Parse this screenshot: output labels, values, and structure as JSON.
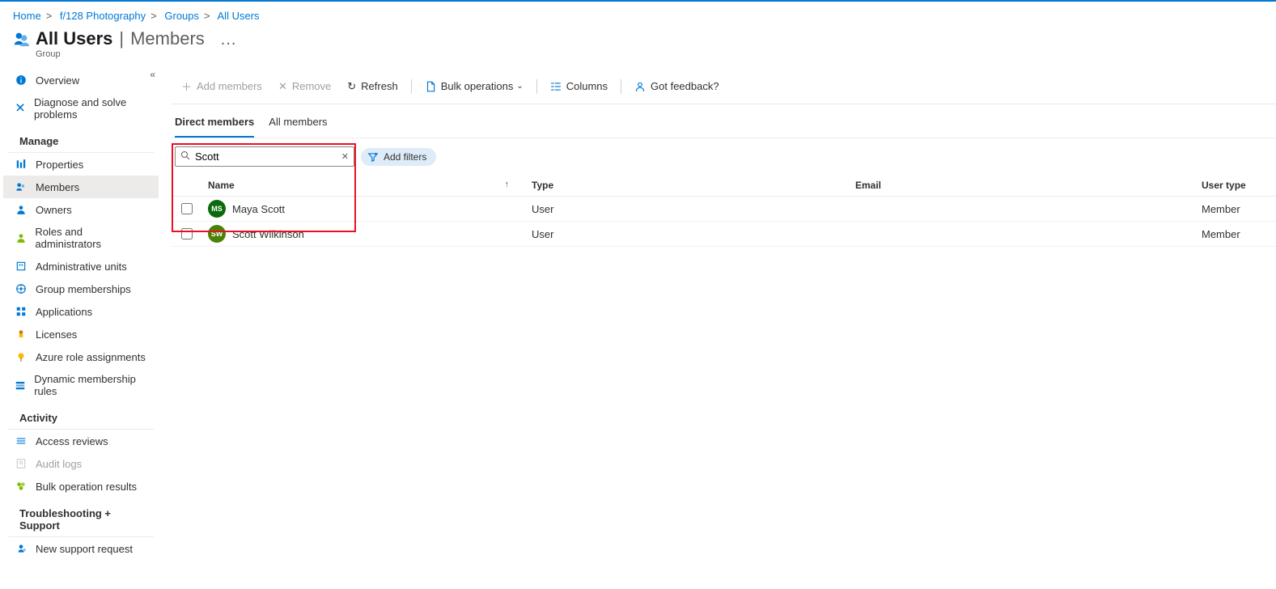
{
  "breadcrumbs": [
    "Home",
    "f/128 Photography",
    "Groups",
    "All Users"
  ],
  "header": {
    "title_main": "All Users",
    "title_second": "Members",
    "subtitle": "Group",
    "more": "..."
  },
  "sidebar": {
    "top": [
      {
        "label": "Overview",
        "icon": "info",
        "color": "#0078d4"
      },
      {
        "label": "Diagnose and solve problems",
        "icon": "diagnose",
        "color": "#0078d4"
      }
    ],
    "sections": [
      {
        "header": "Manage",
        "items": [
          {
            "label": "Properties",
            "icon": "properties",
            "color": "#0078d4"
          },
          {
            "label": "Members",
            "icon": "members",
            "color": "#0078d4",
            "active": true
          },
          {
            "label": "Owners",
            "icon": "owners",
            "color": "#0078d4"
          },
          {
            "label": "Roles and administrators",
            "icon": "roles",
            "color": "#7fba00"
          },
          {
            "label": "Administrative units",
            "icon": "adminunits",
            "color": "#0078d4"
          },
          {
            "label": "Group memberships",
            "icon": "groupmem",
            "color": "#0078d4"
          },
          {
            "label": "Applications",
            "icon": "apps",
            "color": "#0078d4"
          },
          {
            "label": "Licenses",
            "icon": "licenses",
            "color": "#d47300"
          },
          {
            "label": "Azure role assignments",
            "icon": "azurerole",
            "color": "#ffb900"
          },
          {
            "label": "Dynamic membership rules",
            "icon": "dynamic",
            "color": "#0078d4"
          }
        ]
      },
      {
        "header": "Activity",
        "items": [
          {
            "label": "Access reviews",
            "icon": "access",
            "color": "#0078d4"
          },
          {
            "label": "Audit logs",
            "icon": "audit",
            "color": "#a19f9d",
            "disabled": true
          },
          {
            "label": "Bulk operation results",
            "icon": "bulkres",
            "color": "#7fba00"
          }
        ]
      },
      {
        "header": "Troubleshooting + Support",
        "items": [
          {
            "label": "New support request",
            "icon": "support",
            "color": "#0078d4"
          }
        ]
      }
    ]
  },
  "toolbar": {
    "add_members": "Add members",
    "remove": "Remove",
    "refresh": "Refresh",
    "bulk_ops": "Bulk operations",
    "columns": "Columns",
    "feedback": "Got feedback?"
  },
  "tabs": {
    "direct": "Direct members",
    "all": "All members"
  },
  "search": {
    "value": "Scott"
  },
  "add_filters_label": "Add filters",
  "columns": {
    "name": "Name",
    "type": "Type",
    "email": "Email",
    "usertype": "User type"
  },
  "rows": [
    {
      "initials": "MS",
      "avatarColor": "#0b6a0b",
      "name": "Maya Scott",
      "type": "User",
      "email": "",
      "usertype": "Member"
    },
    {
      "initials": "SW",
      "avatarColor": "#498205",
      "name": "Scott Wilkinson",
      "type": "User",
      "email": "",
      "usertype": "Member"
    }
  ]
}
